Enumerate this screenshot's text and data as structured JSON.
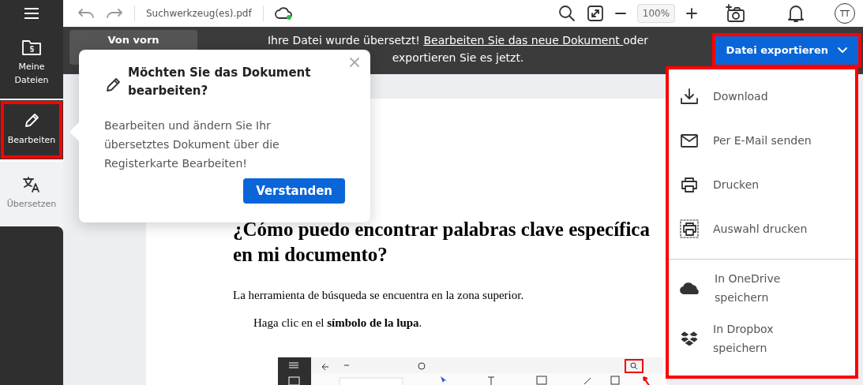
{
  "toolbar": {
    "filename": "Suchwerkzeug(es).pdf",
    "zoom": "100%",
    "avatar": "TT"
  },
  "sidebar": {
    "items": [
      {
        "label": "Meine Dateien",
        "kind": "files",
        "selected": false,
        "highlighted": false
      },
      {
        "label": "Bearbeiten",
        "kind": "edit",
        "selected": false,
        "highlighted": true
      },
      {
        "label": "Übersetzen",
        "kind": "translate",
        "selected": true,
        "highlighted": false
      }
    ]
  },
  "banner": {
    "button": "Von vorn",
    "message": "Ihre Datei wurde übersetzt! ",
    "link": "Bearbeiten Sie das neue Dokument ",
    "message_end": "oder exportieren Sie es jetzt.",
    "export_button": {
      "label": "Datei exportieren",
      "highlighted": true
    }
  },
  "popup": {
    "title": "Möchten Sie das Dokument bearbeiten?",
    "body": "Bearbeiten und ändern Sie Ihr übersetztes Dokument über die Registerkarte Bearbeiten!",
    "button": "Verstanden"
  },
  "export_menu": {
    "highlighted": true,
    "sections": [
      [
        {
          "label": "Download",
          "kind": "download"
        },
        {
          "label": "Per E-Mail senden",
          "kind": "mail"
        },
        {
          "label": "Drucken",
          "kind": "print"
        },
        {
          "label": "Auswahl drucken",
          "kind": "print-selection"
        }
      ],
      [
        {
          "label": "In OneDrive speichern",
          "kind": "onedrive"
        },
        {
          "label": "In Dropbox speichern",
          "kind": "dropbox"
        }
      ]
    ]
  },
  "document": {
    "heading": [
      "¿Cómo puedo encontrar palabras clave específica",
      "en mi documento?"
    ],
    "paragraphs": [
      {
        "text": "La herramienta de búsqueda se encuentra en la zona superior.",
        "indented": false
      },
      {
        "text": "Haga clic en el **símbolo de la lupa**.",
        "indented": true
      }
    ]
  }
}
